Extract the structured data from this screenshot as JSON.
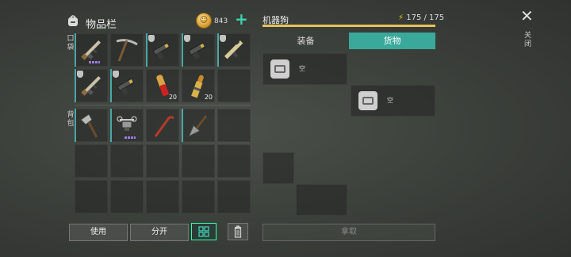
{
  "inventory": {
    "title": "物品栏",
    "coins": "843",
    "pocket_label": "口袋",
    "backpack_label": "背包",
    "pocket_items": [
      {
        "name": "rifle-item",
        "qty": "",
        "shield": false,
        "dots": true,
        "selected": true
      },
      {
        "name": "pickaxe-item",
        "qty": "",
        "shield": false,
        "dots": false,
        "selected": false
      },
      {
        "name": "pistol-item",
        "qty": "",
        "shield": true,
        "dots": false,
        "selected": true
      },
      {
        "name": "pistol-item",
        "qty": "",
        "shield": true,
        "dots": false,
        "selected": true
      },
      {
        "name": "smg-item",
        "qty": "",
        "shield": true,
        "dots": false,
        "selected": true
      },
      {
        "name": "rifle-item",
        "qty": "",
        "shield": true,
        "dots": false,
        "selected": true
      },
      {
        "name": "pistol-item",
        "qty": "",
        "shield": true,
        "dots": false,
        "selected": true
      },
      {
        "name": "red-shell-ammo-item",
        "qty": "20",
        "shield": false,
        "dots": false,
        "selected": false
      },
      {
        "name": "rifle-ammo-item",
        "qty": "20",
        "shield": false,
        "dots": false,
        "selected": false
      },
      {
        "name": "empty",
        "qty": "",
        "shield": false,
        "dots": false,
        "selected": false
      }
    ],
    "backpack_items": [
      {
        "name": "hatchet-item",
        "qty": "",
        "shield": false,
        "dots": false,
        "selected": true
      },
      {
        "name": "drone-item",
        "qty": "",
        "shield": false,
        "dots": true,
        "selected": true
      },
      {
        "name": "crowbar-item",
        "qty": "",
        "shield": false,
        "dots": false,
        "selected": false
      },
      {
        "name": "shovel-item",
        "qty": "",
        "shield": false,
        "dots": false,
        "selected": true
      },
      {
        "name": "empty"
      },
      {
        "name": "empty"
      },
      {
        "name": "empty"
      },
      {
        "name": "empty"
      },
      {
        "name": "empty"
      },
      {
        "name": "empty"
      },
      {
        "name": "empty"
      },
      {
        "name": "empty"
      },
      {
        "name": "empty"
      },
      {
        "name": "empty"
      },
      {
        "name": "empty"
      }
    ]
  },
  "buttons": {
    "use": "使用",
    "split": "分开"
  },
  "robot_dog": {
    "name": "机器狗",
    "energy": "175 / 175",
    "tabs": [
      "装备",
      "货物"
    ],
    "active_tab": "货物",
    "slots": [
      {
        "label": "空"
      },
      {
        "label": "空"
      }
    ],
    "take_label": "拿取"
  },
  "close_label": "关闭",
  "colors": {
    "accent": "#3aa89a",
    "energy_bar": "#e5c35a",
    "rarity_dots": "#9a7ae8"
  }
}
